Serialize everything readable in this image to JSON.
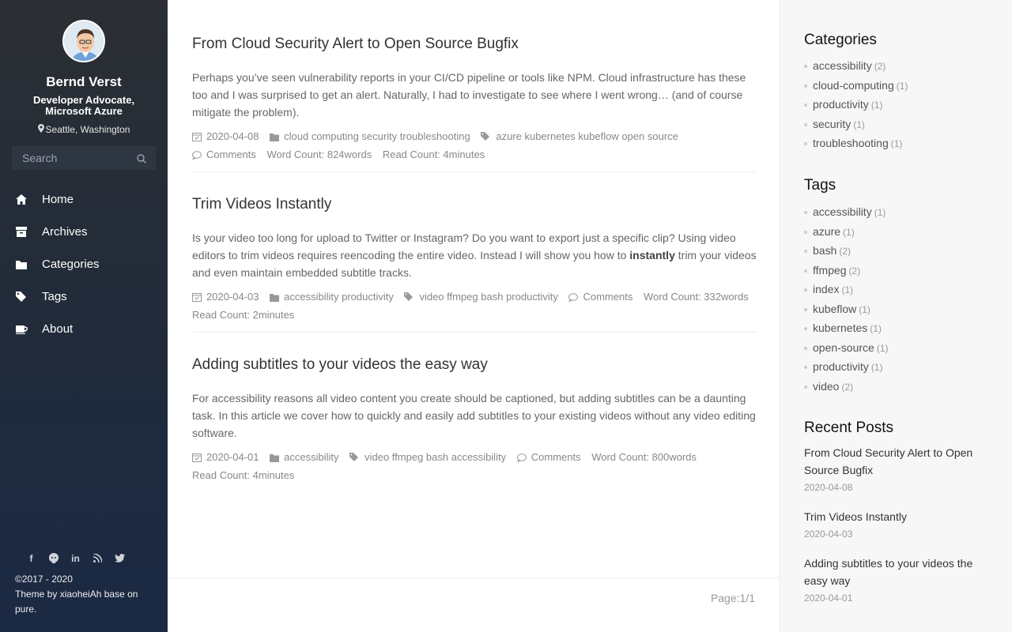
{
  "profile": {
    "name": "Bernd Verst",
    "role": "Developer Advocate, Microsoft Azure",
    "location": "Seattle, Washington"
  },
  "search": {
    "placeholder": "Search"
  },
  "nav": [
    {
      "label": "Home",
      "icon": "home-icon"
    },
    {
      "label": "Archives",
      "icon": "archive-icon"
    },
    {
      "label": "Categories",
      "icon": "folder-icon"
    },
    {
      "label": "Tags",
      "icon": "tags-icon"
    },
    {
      "label": "About",
      "icon": "coffee-icon"
    }
  ],
  "social": [
    "facebook-icon",
    "github-icon",
    "linkedin-icon",
    "rss-icon",
    "twitter-icon"
  ],
  "footer": {
    "copyright": "©2017 - 2020",
    "theme": "Theme by xiaoheiAh base on pure."
  },
  "posts": [
    {
      "title": "From Cloud Security Alert to Open Source Bugfix",
      "excerpt": "Perhaps you’ve seen vulnerability reports in your CI/CD pipeline or tools like NPM. Cloud infrastructure has these too and I was surprised to get an alert. Naturally, I had to investigate to see where I went wrong… (and of course mitigate the problem).",
      "date": "2020-04-08",
      "categories": "cloud computing security troubleshooting",
      "tags": "azure kubernetes kubeflow open source",
      "comments": "Comments",
      "word_count": "Word Count: 824words",
      "read_count": "Read Count: 4minutes"
    },
    {
      "title": "Trim Videos Instantly",
      "excerpt_before": "Is your video too long for upload to Twitter or Instagram? Do you want to export just a specific clip? Using video editors to trim videos requires reencoding the entire video. Instead I will show you how to ",
      "excerpt_bold": "instantly",
      "excerpt_after": " trim your videos and even maintain embedded subtitle tracks.",
      "date": "2020-04-03",
      "categories": "accessibility productivity",
      "tags": "video ffmpeg bash productivity",
      "comments": "Comments",
      "word_count": "Word Count: 332words",
      "read_count": "Read Count: 2minutes"
    },
    {
      "title": "Adding subtitles to your videos the easy way",
      "excerpt": "For accessibility reasons all video content you create should be captioned, but adding subtitles can be a daunting task. In this article we cover how to quickly and easily add subtitles to your existing videos without any video editing software.",
      "date": "2020-04-01",
      "categories": "accessibility",
      "tags": "video ffmpeg bash accessibility",
      "comments": "Comments",
      "word_count": "Word Count: 800words",
      "read_count": "Read Count: 4minutes"
    }
  ],
  "pager": "Page:1/1",
  "right": {
    "categories_title": "Categories",
    "categories": [
      {
        "name": "accessibility",
        "count": "(2)"
      },
      {
        "name": "cloud-computing",
        "count": "(1)"
      },
      {
        "name": "productivity",
        "count": "(1)"
      },
      {
        "name": "security",
        "count": "(1)"
      },
      {
        "name": "troubleshooting",
        "count": "(1)"
      }
    ],
    "tags_title": "Tags",
    "tags": [
      {
        "name": "accessibility",
        "count": "(1)"
      },
      {
        "name": "azure",
        "count": "(1)"
      },
      {
        "name": "bash",
        "count": "(2)"
      },
      {
        "name": "ffmpeg",
        "count": "(2)"
      },
      {
        "name": "index",
        "count": "(1)"
      },
      {
        "name": "kubeflow",
        "count": "(1)"
      },
      {
        "name": "kubernetes",
        "count": "(1)"
      },
      {
        "name": "open-source",
        "count": "(1)"
      },
      {
        "name": "productivity",
        "count": "(1)"
      },
      {
        "name": "video",
        "count": "(2)"
      }
    ],
    "recent_title": "Recent Posts",
    "recent": [
      {
        "title": "From Cloud Security Alert to Open Source Bugfix",
        "date": "2020-04-08"
      },
      {
        "title": "Trim Videos Instantly",
        "date": "2020-04-03"
      },
      {
        "title": "Adding subtitles to your videos the easy way",
        "date": "2020-04-01"
      }
    ]
  }
}
